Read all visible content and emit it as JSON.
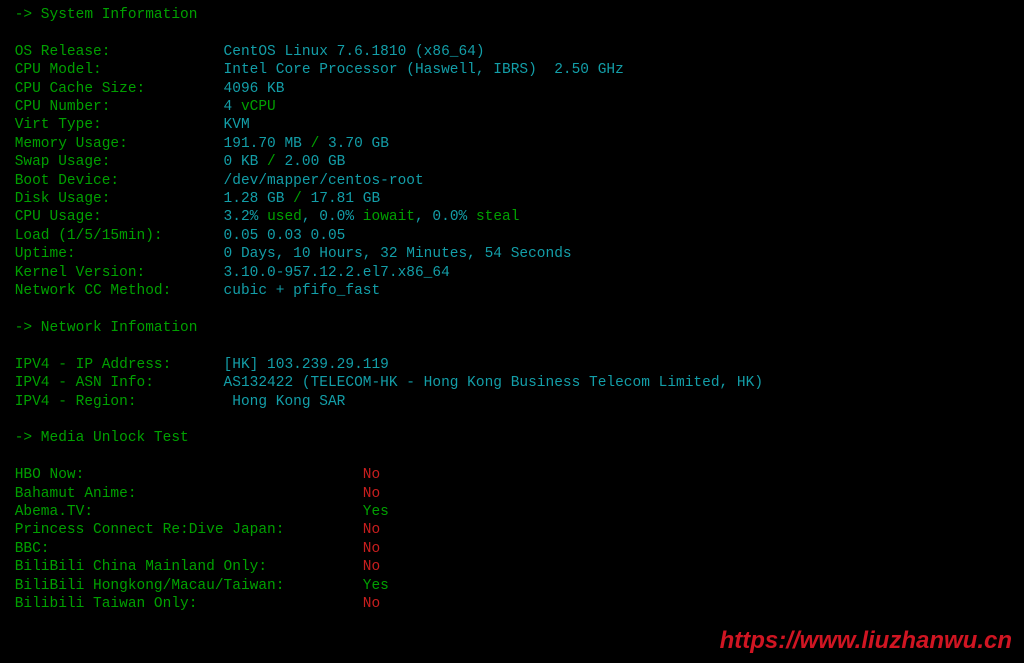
{
  "sections": {
    "sys_header": " -> System Information",
    "net_header": " -> Network Infomation",
    "media_header": " -> Media Unlock Test"
  },
  "sys": {
    "os": {
      "label": " OS Release:",
      "value": "CentOS Linux 7.6.1810 (x86_64)"
    },
    "cpu_model": {
      "label": " CPU Model:",
      "value": "Intel Core Processor (Haswell, IBRS)  2.50 GHz"
    },
    "cache": {
      "label": " CPU Cache Size:",
      "value": "4096 KB"
    },
    "cpu_num": {
      "label": " CPU Number:",
      "count": "4",
      "suffix": " vCPU"
    },
    "virt": {
      "label": " Virt Type:",
      "value": "KVM"
    },
    "mem": {
      "label": " Memory Usage:",
      "used": "191.70 MB",
      "sep": " / ",
      "total": "3.70 GB"
    },
    "swap": {
      "label": " Swap Usage:",
      "used": "0 KB",
      "sep": " / ",
      "total": "2.00 GB"
    },
    "boot": {
      "label": " Boot Device:",
      "value": "/dev/mapper/centos-root"
    },
    "disk": {
      "label": " Disk Usage:",
      "used": "1.28 GB",
      "sep": " / ",
      "total": "17.81 GB"
    },
    "cpuusage": {
      "label": " CPU Usage:",
      "p1": "3.2% ",
      "w1": "used",
      "s1": ", ",
      "p2": "0.0% ",
      "w2": "iowait",
      "s2": ", ",
      "p3": "0.0% ",
      "w3": "steal"
    },
    "load": {
      "label": " Load (1/5/15min):",
      "value": "0.05 0.03 0.05"
    },
    "uptime": {
      "label": " Uptime:",
      "value": "0 Days, 10 Hours, 32 Minutes, 54 Seconds"
    },
    "kernel": {
      "label": " Kernel Version:",
      "value": "3.10.0-957.12.2.el7.x86_64"
    },
    "cc": {
      "label": " Network CC Method:",
      "value": "cubic + pfifo_fast"
    }
  },
  "net": {
    "ip": {
      "label": " IPV4 - IP Address:",
      "value": "[HK] 103.239.29.119"
    },
    "asn": {
      "label": " IPV4 - ASN Info:",
      "value": "AS132422 (TELECOM-HK - Hong Kong Business Telecom Limited, HK)"
    },
    "region": {
      "label": " IPV4 - Region:",
      "value": " Hong Kong SAR"
    }
  },
  "media": [
    {
      "label": " HBO Now:",
      "status": "No",
      "color": "red"
    },
    {
      "label": " Bahamut Anime:",
      "status": "No",
      "color": "red"
    },
    {
      "label": " Abema.TV:",
      "status": "Yes",
      "color": "green"
    },
    {
      "label": " Princess Connect Re:Dive Japan:",
      "status": "No",
      "color": "red"
    },
    {
      "label": " BBC:",
      "status": "No",
      "color": "red"
    },
    {
      "label": " BiliBili China Mainland Only:",
      "status": "No",
      "color": "red"
    },
    {
      "label": " BiliBili Hongkong/Macau/Taiwan:",
      "status": "Yes",
      "color": "green"
    },
    {
      "label": " Bilibili Taiwan Only:",
      "status": "No",
      "color": "red"
    }
  ],
  "watermark": "https://www.liuzhanwu.cn"
}
